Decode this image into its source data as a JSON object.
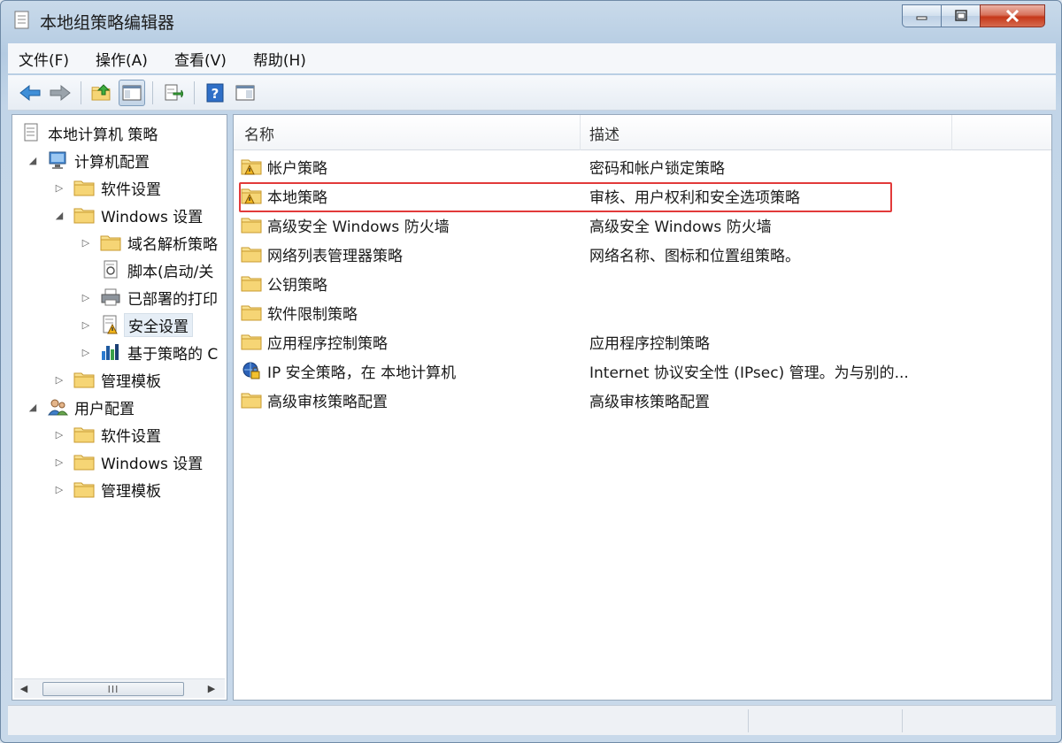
{
  "window": {
    "title": "本地组策略编辑器"
  },
  "menu": [
    {
      "label": "文件(F)"
    },
    {
      "label": "操作(A)"
    },
    {
      "label": "查看(V)"
    },
    {
      "label": "帮助(H)"
    }
  ],
  "tree": {
    "root": "本地计算机 策略",
    "computer_config": "计算机配置",
    "software_settings": "软件设置",
    "windows_settings": "Windows 设置",
    "name_resolution": "域名解析策略",
    "scripts": "脚本(启动/关",
    "printers": "已部署的打印",
    "security_settings": "安全设置",
    "policy_qos": "基于策略的 C",
    "admin_templates": "管理模板",
    "user_config": "用户配置",
    "user_software_settings": "软件设置",
    "user_windows_settings": "Windows 设置",
    "user_admin_templates": "管理模板",
    "scroll_thumb": "III"
  },
  "list": {
    "columns": {
      "name": "名称",
      "description": "描述"
    },
    "rows": [
      {
        "name": "帐户策略",
        "description": "密码和帐户锁定策略",
        "icon": "folder-lock-icon"
      },
      {
        "name": "本地策略",
        "description": "审核、用户权利和安全选项策略",
        "icon": "folder-lock-icon"
      },
      {
        "name": "高级安全 Windows 防火墙",
        "description": "高级安全 Windows 防火墙",
        "icon": "folder-icon"
      },
      {
        "name": "网络列表管理器策略",
        "description": "网络名称、图标和位置组策略。",
        "icon": "folder-icon"
      },
      {
        "name": "公钥策略",
        "description": "",
        "icon": "folder-icon"
      },
      {
        "name": "软件限制策略",
        "description": "",
        "icon": "folder-icon"
      },
      {
        "name": "应用程序控制策略",
        "description": "应用程序控制策略",
        "icon": "folder-icon"
      },
      {
        "name": "IP 安全策略，在 本地计算机",
        "description": "Internet 协议安全性 (IPsec) 管理。为与别的...",
        "icon": "ipsec-icon"
      },
      {
        "name": "高级审核策略配置",
        "description": "高级审核策略配置",
        "icon": "folder-icon"
      }
    ]
  },
  "colors": {
    "highlight_border": "#e23a3a",
    "folder": "#f0c850"
  }
}
